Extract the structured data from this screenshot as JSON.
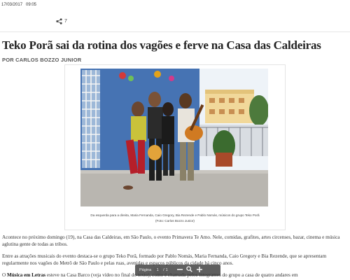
{
  "header": {
    "date": "17/03/2017",
    "time": "09:05",
    "share_count": "7",
    "share_icon": "share-icon"
  },
  "article": {
    "title": "Teko Porã sai da rotina dos vagões e ferve na Casa das Caldeiras",
    "byline": "POR CARLOS BOZZO JUNIOR",
    "caption_line1": "Da esquerda para a direita, Maria Fernanda, Caio Gregory, Bia Rezende e Pablo Nomás, músicos do grupo Teko Porã",
    "caption_line2": "(Foto: Carlos Bozzo Junior)",
    "p1": "Acontece no próximo domingo (19), na Casa das Caldeiras, em São Paulo, o evento Primavera Te Amo. Nele, comidas, grafites, artes circenses, bazar, cinema e música aglutina gente de todas as tribos.",
    "p2": "Entre as atrações musicais do evento destaca-se o grupo Teko Porã, formado por Pablo Nomás, Maria Fernanda, Caio Gregory e Bia Rezende, que se apresentam regularmente nos vagões do Metrô de São Paulo e pelas ruas, avenidas e espaços públicos da cidade há cinco anos.",
    "p3_prefix": "O ",
    "p3_bold": "Música em Letras",
    "p3_rest": " esteve na Casa Barco (veja vídeo no final do texto), como é chamada pelos integrantes do grupo a casa de quatro andares em"
  },
  "pager": {
    "label": "Página",
    "current": "1",
    "separator": "/",
    "total": "1",
    "zoom_out_icon": "minus-icon",
    "search_icon": "magnifier-icon",
    "zoom_in_icon": "plus-icon"
  },
  "colors": {
    "title": "#222222",
    "byline": "#555555",
    "pager_bg": "#323232",
    "wall_blue": "#4a78b8"
  }
}
